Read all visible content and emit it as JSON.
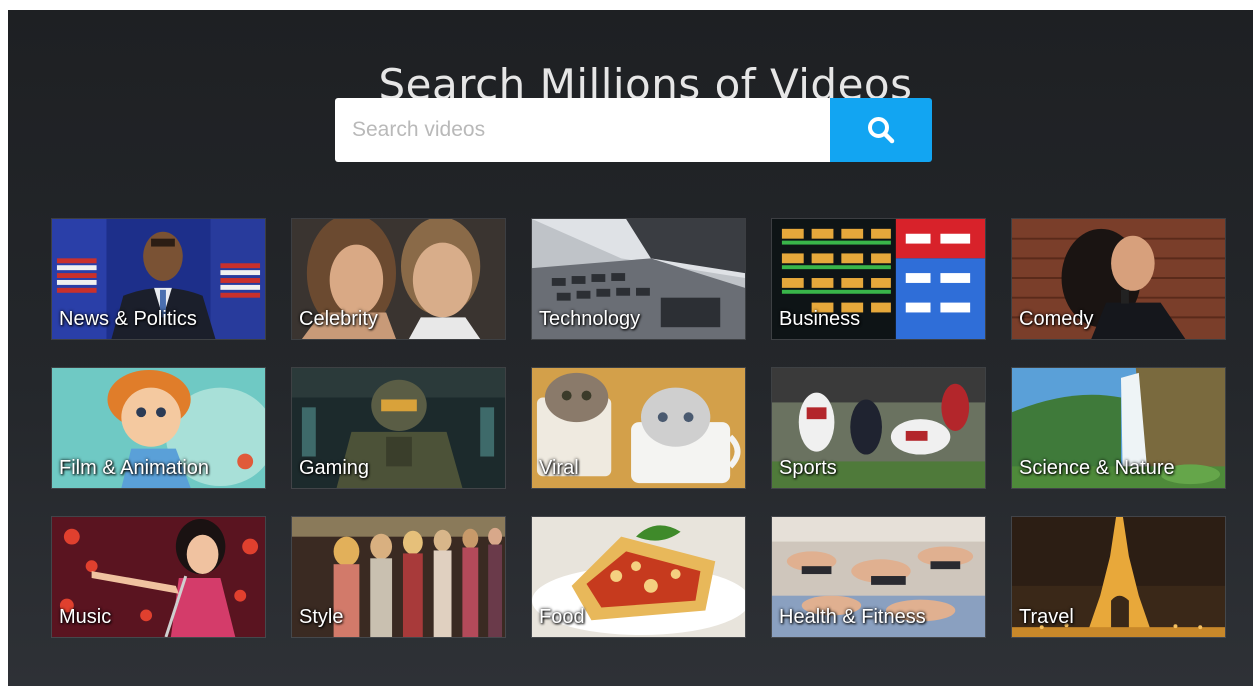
{
  "page": {
    "title": "Search Millions of Videos"
  },
  "search": {
    "placeholder": "Search videos",
    "value": "",
    "button_icon": "search-icon",
    "button_color": "#12a5f2"
  },
  "categories": [
    {
      "label": "News & Politics",
      "image": "politician at podium with flags"
    },
    {
      "label": "Celebrity",
      "image": "celebrity couple portrait"
    },
    {
      "label": "Technology",
      "image": "laptop keyboard close-up"
    },
    {
      "label": "Business",
      "image": "stock ticker board"
    },
    {
      "label": "Comedy",
      "image": "comedian at microphone"
    },
    {
      "label": "Film & Animation",
      "image": "animated cartoon girl"
    },
    {
      "label": "Gaming",
      "image": "armored video game soldier"
    },
    {
      "label": "Viral",
      "image": "kittens in teacups"
    },
    {
      "label": "Sports",
      "image": "football players tackling"
    },
    {
      "label": "Science & Nature",
      "image": "waterfall landscape"
    },
    {
      "label": "Music",
      "image": "singer on stage"
    },
    {
      "label": "Style",
      "image": "fashion runway models"
    },
    {
      "label": "Food",
      "image": "plate of lasagna"
    },
    {
      "label": "Health & Fitness",
      "image": "yoga class stretching"
    },
    {
      "label": "Travel",
      "image": "Eiffel Tower at night"
    }
  ]
}
